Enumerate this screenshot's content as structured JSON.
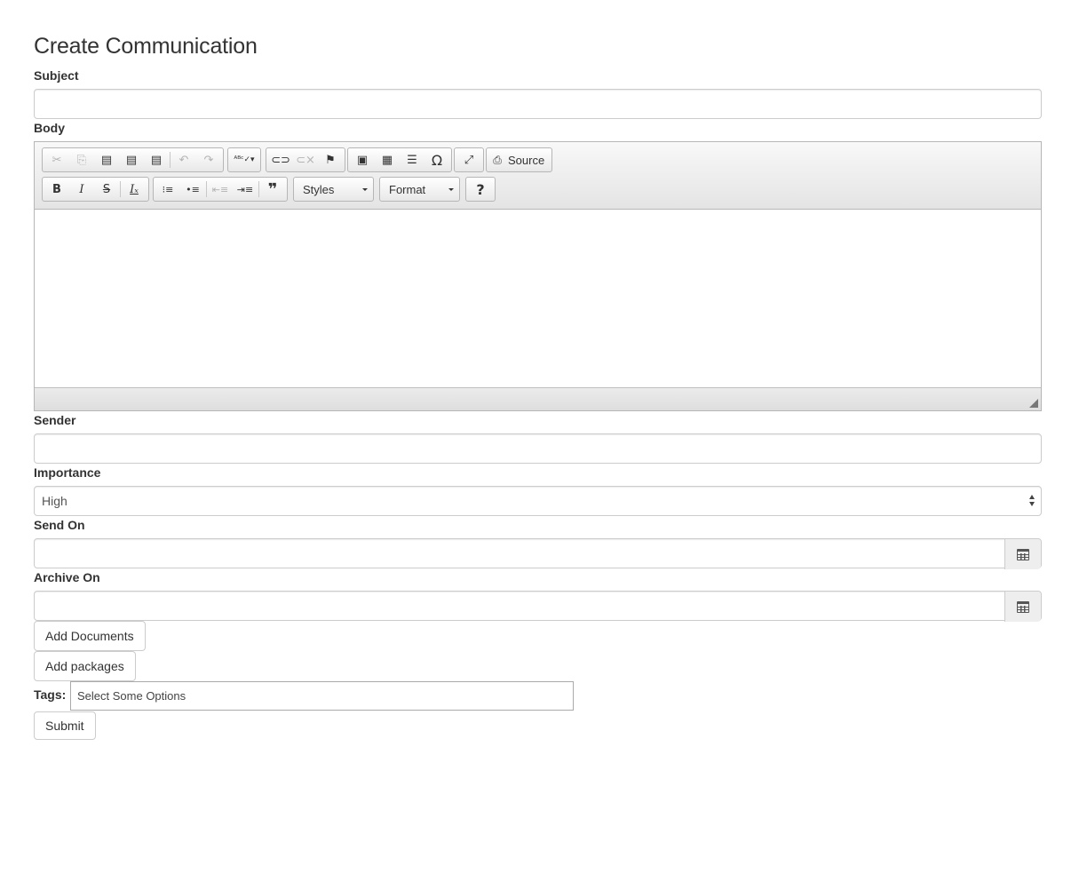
{
  "page": {
    "title": "Create Communication"
  },
  "form": {
    "subject_label": "Subject",
    "subject_value": "",
    "body_label": "Body",
    "sender_label": "Sender",
    "sender_value": "",
    "importance_label": "Importance",
    "importance_selected": "High",
    "send_on_label": "Send On",
    "archive_on_label": "Archive On",
    "add_documents": "Add Documents",
    "add_packages": "Add packages",
    "tags_label": "Tags:",
    "tags_placeholder": "Select Some Options",
    "submit": "Submit"
  },
  "editor": {
    "row1": [
      {
        "icon": "cut-icon",
        "glyph": "✂",
        "enabled": false
      },
      {
        "icon": "copy-icon",
        "glyph": "⎘",
        "enabled": false
      },
      {
        "icon": "paste-icon",
        "glyph": "📋",
        "enabled": true
      },
      {
        "icon": "paste-text-icon",
        "glyph": "📋",
        "enabled": true
      },
      {
        "icon": "paste-word-icon",
        "glyph": "📋",
        "enabled": true
      },
      {
        "icon": "undo-icon",
        "glyph": "↶",
        "enabled": false
      },
      {
        "icon": "redo-icon",
        "glyph": "↷",
        "enabled": false
      },
      {
        "icon": "spellcheck-icon",
        "glyph": "ABC✓",
        "enabled": true
      },
      {
        "icon": "link-icon",
        "glyph": "🔗",
        "enabled": true
      },
      {
        "icon": "unlink-icon",
        "glyph": "⛓",
        "enabled": false
      },
      {
        "icon": "anchor-icon",
        "glyph": "⚑",
        "enabled": true
      },
      {
        "icon": "image-icon",
        "glyph": "🖼",
        "enabled": true
      },
      {
        "icon": "table-icon",
        "glyph": "▦",
        "enabled": true
      },
      {
        "icon": "horizontal-line-icon",
        "glyph": "☰",
        "enabled": true
      },
      {
        "icon": "special-char-icon",
        "glyph": "Ω",
        "enabled": true
      },
      {
        "icon": "maximize-icon",
        "glyph": "⤢",
        "enabled": true
      },
      {
        "icon": "source-icon",
        "glyph": "⎙",
        "enabled": true
      }
    ],
    "source_label": "Source",
    "row2": [
      {
        "icon": "bold-icon",
        "glyph": "B"
      },
      {
        "icon": "italic-icon",
        "glyph": "I"
      },
      {
        "icon": "strike-icon",
        "glyph": "S"
      },
      {
        "icon": "remove-format-icon",
        "glyph": "Iₓ"
      },
      {
        "icon": "numbered-list-icon",
        "glyph": "⒈≡"
      },
      {
        "icon": "bulleted-list-icon",
        "glyph": "•≡"
      },
      {
        "icon": "outdent-icon",
        "glyph": "⇤"
      },
      {
        "icon": "indent-icon",
        "glyph": "⇥"
      },
      {
        "icon": "blockquote-icon",
        "glyph": "❞"
      },
      {
        "icon": "help-icon",
        "glyph": "?"
      }
    ],
    "styles_label": "Styles",
    "format_label": "Format"
  }
}
